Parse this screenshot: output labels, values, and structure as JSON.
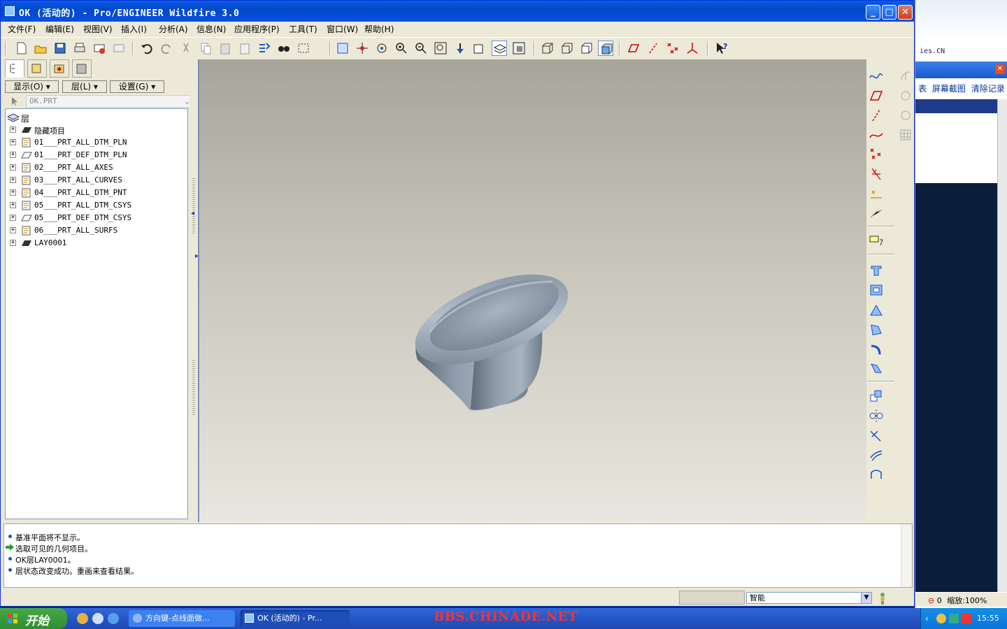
{
  "window": {
    "title": "OK (活动的) - Pro/ENGINEER Wildfire 3.0",
    "minimize_label": "_",
    "maximize_label": "□",
    "close_label": "✕"
  },
  "menu": {
    "items": [
      "文件(F)",
      "编辑(E)",
      "视图(V)",
      "插入(I)",
      "分析(A)",
      "信息(N)",
      "应用程序(P)",
      "工具(T)",
      "窗口(W)",
      "帮助(H)"
    ]
  },
  "navigator": {
    "buttons": {
      "show": "显示(O)",
      "layer": "层(L)",
      "settings": "设置(G)"
    },
    "part_selector": "OK.PRT",
    "tree_root": "层",
    "layers": [
      {
        "label": "隐藏项目",
        "icon": "hidden-layer-icon"
      },
      {
        "label": "01___PRT_ALL_DTM_PLN",
        "icon": "layer-rule-icon"
      },
      {
        "label": "01___PRT_DEF_DTM_PLN",
        "icon": "layer-plane-icon"
      },
      {
        "label": "02___PRT_ALL_AXES",
        "icon": "layer-rule-icon"
      },
      {
        "label": "03___PRT_ALL_CURVES",
        "icon": "layer-rule-icon"
      },
      {
        "label": "04___PRT_ALL_DTM_PNT",
        "icon": "layer-rule-icon"
      },
      {
        "label": "05___PRT_ALL_DTM_CSYS",
        "icon": "layer-rule-icon"
      },
      {
        "label": "05___PRT_DEF_DTM_CSYS",
        "icon": "layer-plane-icon"
      },
      {
        "label": "06___PRT_ALL_SURFS",
        "icon": "layer-rule-icon"
      },
      {
        "label": "LAY0001",
        "icon": "hidden-layer-icon"
      }
    ]
  },
  "messages": [
    {
      "type": "info",
      "text": "基准平面将不显示。"
    },
    {
      "type": "prompt",
      "text": "选取可见的几何项目。"
    },
    {
      "type": "info",
      "text": "OK层LAY0001。"
    },
    {
      "type": "info",
      "text": "层状态改变成功。重画来查看结果。"
    }
  ],
  "status": {
    "filter": "智能"
  },
  "background_app": {
    "site": "ies.CN",
    "links": [
      "表",
      "屏幕截图",
      "清除记录"
    ],
    "zoom": "缩放:100%",
    "count": "0"
  },
  "taskbar": {
    "start_label": "开始",
    "tasks": [
      "方向键-点线面做...",
      "OK (活动的) - Pr..."
    ],
    "watermark": "BBS.CHINADE.NET",
    "clock": "15:55"
  },
  "colors": {
    "titlebar": "#0a5ce6",
    "viewport_top": "#a7a599",
    "viewport_bottom": "#e8e7df",
    "model": "#8f9cab",
    "watermark": "#ff3030"
  }
}
